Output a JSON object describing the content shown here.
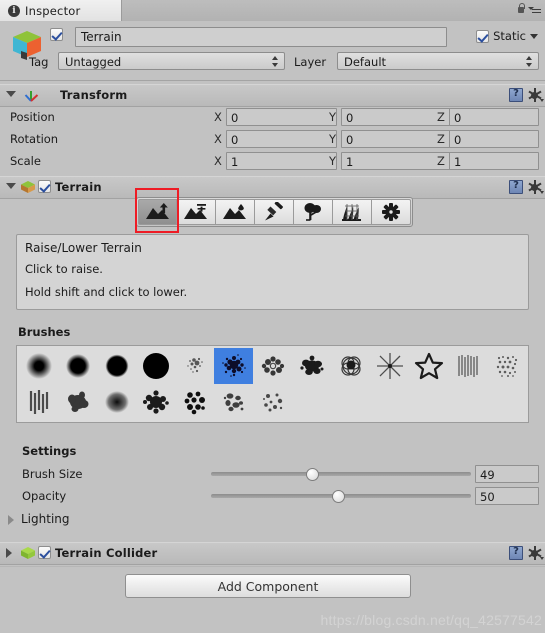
{
  "window": {
    "tab_label": "Inspector",
    "tab_icon": "info-icon",
    "lock_icon": "lock-icon",
    "menu_icon": "hamburger-menu-icon"
  },
  "object_header": {
    "enabled": true,
    "name_value": "Terrain",
    "static_label": "Static",
    "static_checked": true,
    "tag_label": "Tag",
    "tag_value": "Untagged",
    "layer_label": "Layer",
    "layer_value": "Default",
    "prefab_icon": "unity-cube-icon"
  },
  "transform": {
    "title": "Transform",
    "icon": "transform-axis-icon",
    "help_icon": "help-book-icon",
    "gear_icon": "gear-icon",
    "rows": [
      {
        "label": "Position",
        "x": "0",
        "y": "0",
        "z": "0"
      },
      {
        "label": "Rotation",
        "x": "0",
        "y": "0",
        "z": "0"
      },
      {
        "label": "Scale",
        "x": "1",
        "y": "1",
        "z": "1"
      }
    ],
    "axis_labels": {
      "x": "X",
      "y": "Y",
      "z": "Z"
    }
  },
  "terrain": {
    "title": "Terrain",
    "enabled": true,
    "icon": "terrain-component-icon",
    "help_icon": "help-book-icon",
    "gear_icon": "gear-icon",
    "toolbar": {
      "selected_index": 0,
      "highlight_color": "#ee1c25",
      "tools": [
        {
          "name": "raise-lower-terrain-tool",
          "icon": "mountain-up-arrow-icon"
        },
        {
          "name": "paint-height-tool",
          "icon": "mountain-height-icon"
        },
        {
          "name": "smooth-height-tool",
          "icon": "mountain-smooth-icon"
        },
        {
          "name": "paint-texture-tool",
          "icon": "paintbrush-icon"
        },
        {
          "name": "place-trees-tool",
          "icon": "tree-icon"
        },
        {
          "name": "paint-details-tool",
          "icon": "grass-details-icon"
        },
        {
          "name": "terrain-settings-tool",
          "icon": "gear-icon"
        }
      ]
    },
    "description": {
      "title": "Raise/Lower Terrain",
      "line1": "Click to raise.",
      "line2": "Hold shift and click to lower."
    },
    "brushes_label": "Brushes",
    "brushes": {
      "selected_index": 5,
      "selected_color": "#3f7fe0",
      "row1": [
        "soft-falloff-brush",
        "medium-falloff-brush",
        "hard-falloff-brush",
        "solid-round-brush",
        "sparse-speckle-brush",
        "dense-speckle-brush",
        "cloud-noise-brush",
        "splatter-cluster-brush",
        "overlapping-blobs-brush",
        "star-burst-brush",
        "star-outline-brush",
        "vertical-streak-brush",
        "fine-noise-brush"
      ],
      "row2": [
        "drip-streak-brush",
        "rough-smudge-brush",
        "soft-smudge-brush",
        "spiky-cluster-brush",
        "dot-cluster-brush",
        "scatter-fragment-brush",
        "sparse-dot-brush"
      ]
    },
    "settings_label": "Settings",
    "settings": [
      {
        "label": "Brush Size",
        "value": "49",
        "percent": 39
      },
      {
        "label": "Opacity",
        "value": "50",
        "percent": 49
      }
    ],
    "lighting_label": "Lighting"
  },
  "terrain_collider": {
    "title": "Terrain Collider",
    "enabled": true,
    "icon": "terrain-collider-icon",
    "help_icon": "help-book-icon",
    "gear_icon": "gear-icon"
  },
  "footer": {
    "add_component_label": "Add Component",
    "watermark": "https://blog.csdn.net/qq_42577542"
  }
}
